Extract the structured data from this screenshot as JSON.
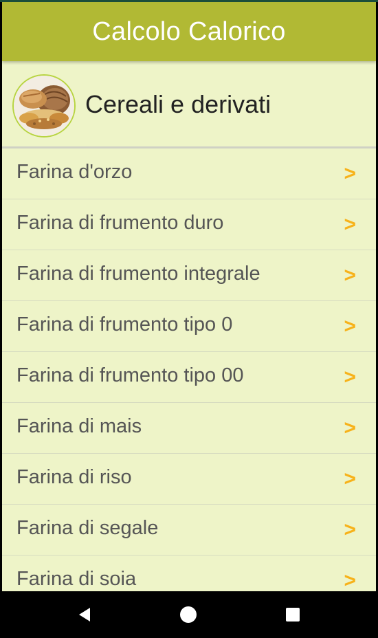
{
  "app": {
    "title": "Calcolo Calorico"
  },
  "category": {
    "title": "Cereali e derivati",
    "icon": "bread-cereals-photo"
  },
  "list": {
    "items": [
      {
        "label": "Farina d'orzo",
        "chevron": ">"
      },
      {
        "label": "Farina di frumento duro",
        "chevron": ">"
      },
      {
        "label": "Farina di frumento integrale",
        "chevron": ">"
      },
      {
        "label": "Farina di frumento tipo 0",
        "chevron": ">"
      },
      {
        "label": "Farina di frumento tipo 00",
        "chevron": ">"
      },
      {
        "label": "Farina di mais",
        "chevron": ">"
      },
      {
        "label": "Farina di riso",
        "chevron": ">"
      },
      {
        "label": "Farina di segale",
        "chevron": ">"
      },
      {
        "label": "Farina di soia",
        "chevron": ">"
      }
    ]
  },
  "navbar": {
    "back_icon": "triangle-back-icon",
    "home_icon": "circle-home-icon",
    "recent_icon": "square-recents-icon"
  },
  "colors": {
    "appbar": "#b1b934",
    "background": "#eef4c8",
    "chevron": "#f7b21a",
    "avatar_border": "#b8d442"
  }
}
